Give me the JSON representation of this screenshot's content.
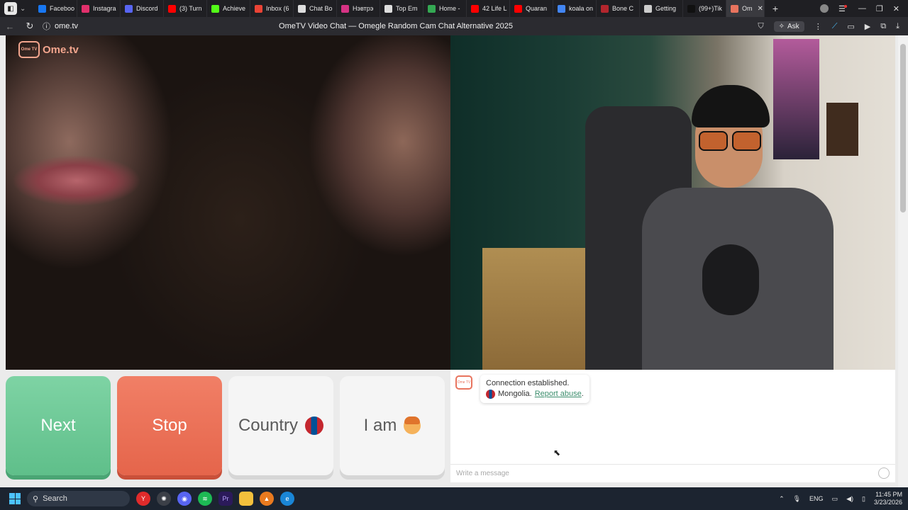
{
  "browser": {
    "tabs": [
      {
        "label": "Faceboo",
        "color": "#1877f2"
      },
      {
        "label": "Instagra",
        "color": "#e1306c"
      },
      {
        "label": "Discord",
        "color": "#5865f2"
      },
      {
        "label": "(3) Turn",
        "color": "#ff0000"
      },
      {
        "label": "Achieve",
        "color": "#53fc18"
      },
      {
        "label": "Inbox (6",
        "color": "#ea4335"
      },
      {
        "label": "Chat Bo",
        "color": "#dddddd"
      },
      {
        "label": "Нэвтрэ",
        "color": "#d63384"
      },
      {
        "label": "Top Em",
        "color": "#dddddd"
      },
      {
        "label": "Home -",
        "color": "#34a853"
      },
      {
        "label": "42 Life L",
        "color": "#ff0000"
      },
      {
        "label": "Quaran",
        "color": "#ff0000"
      },
      {
        "label": "koala on",
        "color": "#4285f4"
      },
      {
        "label": "Bone C",
        "color": "#b3262d"
      },
      {
        "label": "Getting",
        "color": "#cccccc"
      },
      {
        "label": "(99+)Tik",
        "color": "#111111"
      }
    ],
    "active_tab": {
      "label": "Om",
      "close": "✕"
    },
    "new_tab": "+",
    "url": "ome.tv",
    "page_title": "OmeTV Video Chat — Omegle Random Cam Chat Alternative 2025",
    "ask_label": "Ask"
  },
  "site": {
    "logo_text": "Ome.tv",
    "logo_badge": "Ome TV"
  },
  "controls": {
    "next": "Next",
    "stop": "Stop",
    "country": "Country",
    "iam": "I am"
  },
  "chat": {
    "line1": "Connection established.",
    "country": "Mongolia.",
    "report": "Report abuse",
    "report_suffix": ".",
    "placeholder": "Write a message"
  },
  "taskbar": {
    "search": "Search",
    "lang": "ENG",
    "time": "11:45 PM",
    "date": "3/23/2026"
  },
  "colors": {
    "next_green": "#6cc997",
    "stop_red": "#ea6d53",
    "link_green": "#3c8e6d"
  }
}
